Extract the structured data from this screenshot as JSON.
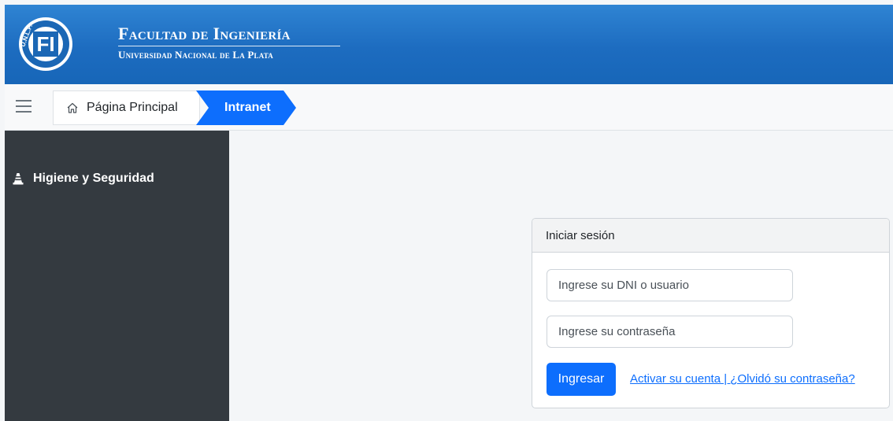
{
  "header": {
    "title": "Facultad de Ingeniería",
    "subtitle": "Universidad Nacional de La Plata",
    "logo_letters": "FI",
    "logo_ring_text": "U.N.L.P.",
    "gradient_top": "#2f84d3",
    "gradient_bottom": "#1766b8"
  },
  "breadcrumb": {
    "menu_icon": "hamburger-icon",
    "home": {
      "label": "Página Principal",
      "icon": "home-icon"
    },
    "active": {
      "label": "Intranet",
      "color": "#0d6efd"
    }
  },
  "sidebar": {
    "background": "#343a40",
    "items": [
      {
        "label": "Higiene y Seguridad",
        "icon": "traffic-cone-icon"
      }
    ]
  },
  "login": {
    "title": "Iniciar sesión",
    "username_placeholder": "Ingrese su DNI o usuario",
    "password_placeholder": "Ingrese su contraseña",
    "submit_label": "Ingresar",
    "links_text": "Activar su cuenta | ¿Olvidó su contraseña?",
    "accent": "#0d6efd"
  }
}
